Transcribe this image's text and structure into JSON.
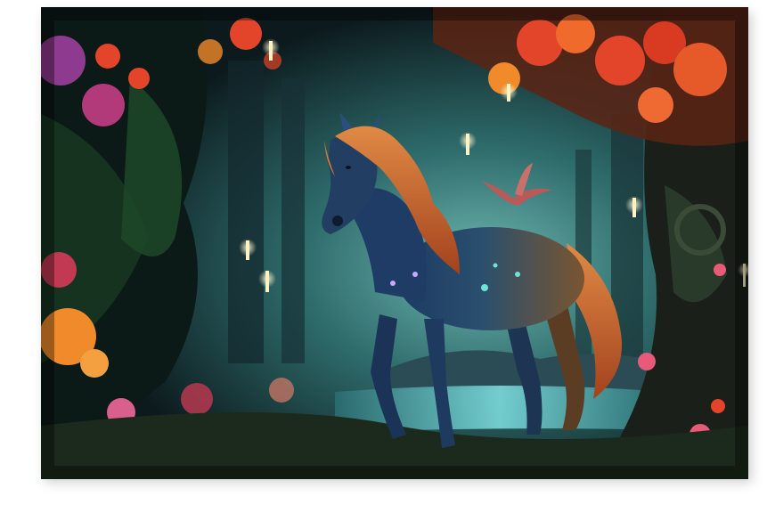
{
  "artwork": {
    "subject": "horse-in-enchanted-forest",
    "palette": {
      "forest_dark": "#0f1e22",
      "teal_glow": "#3f8c8a",
      "water": "#5fc7c9",
      "mane": "#c9642b",
      "horse_blue": "#1f3f66",
      "horse_brown": "#6b4a2a",
      "flower_red": "#e2452a",
      "flower_pink": "#d9608c",
      "flower_orange": "#f08a2a",
      "candle": "#fff2c2"
    }
  }
}
